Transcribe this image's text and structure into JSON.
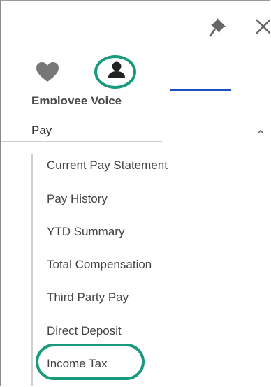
{
  "header": {
    "pin_icon": "pin-icon",
    "close_icon": "close-icon"
  },
  "tabs": [
    {
      "icon": "heart-icon",
      "active": false
    },
    {
      "icon": "person-icon",
      "active": true
    }
  ],
  "colors": {
    "highlight": "#1a9a7d",
    "tab_active_underline": "#1d4fbf"
  },
  "nav": {
    "sections": [
      {
        "label": "Employee Voice"
      },
      {
        "label": "Pay",
        "expanded": true,
        "items": [
          {
            "label": "Current Pay Statement"
          },
          {
            "label": "Pay History"
          },
          {
            "label": "YTD Summary"
          },
          {
            "label": "Total Compensation"
          },
          {
            "label": "Third Party Pay"
          },
          {
            "label": "Direct Deposit"
          },
          {
            "label": "Income Tax",
            "highlighted": true
          }
        ]
      }
    ]
  }
}
